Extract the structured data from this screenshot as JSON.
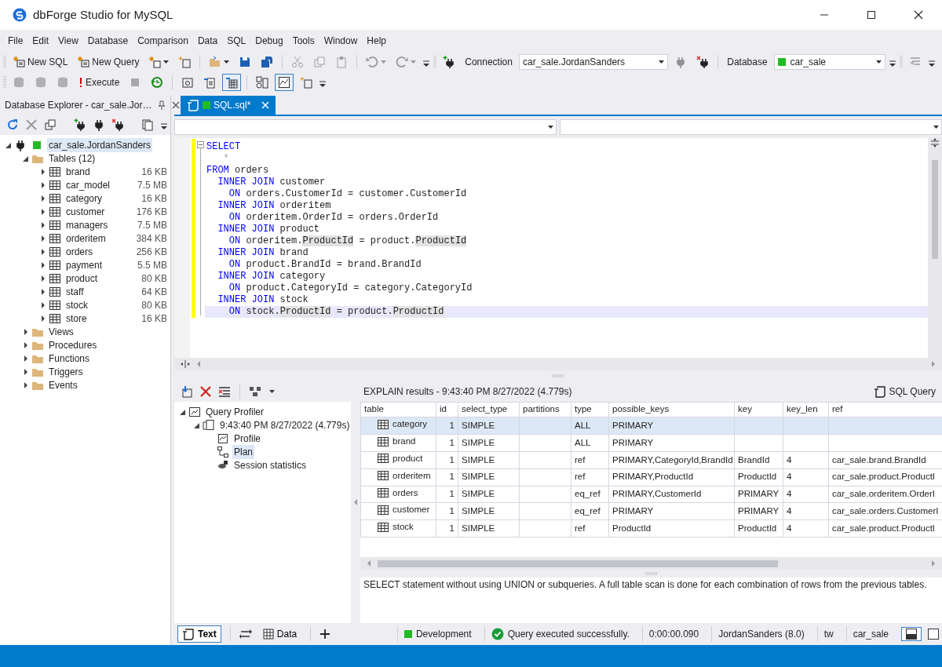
{
  "window": {
    "title": "dbForge Studio for MySQL"
  },
  "menu": [
    "File",
    "Edit",
    "View",
    "Database",
    "Comparison",
    "Data",
    "SQL",
    "Debug",
    "Tools",
    "Window",
    "Help"
  ],
  "toolbar_1": [
    {
      "kind": "button",
      "label": "New SQL"
    },
    {
      "kind": "button",
      "label": "New Query"
    },
    {
      "kind": "dropdown",
      "disabled": false,
      "pressed": false
    },
    {
      "kind": "icon",
      "disabled": false,
      "pressed": false
    },
    {
      "kind": "separator"
    },
    {
      "kind": "dropdown",
      "disabled": false,
      "pressed": false
    },
    {
      "kind": "icon",
      "disabled": false,
      "pressed": false
    },
    {
      "kind": "icon",
      "disabled": false,
      "pressed": false
    },
    {
      "kind": "separator"
    },
    {
      "kind": "icon",
      "disabled": true,
      "pressed": false
    },
    {
      "kind": "icon",
      "disabled": true,
      "pressed": false
    },
    {
      "kind": "icon",
      "disabled": true,
      "pressed": false
    },
    {
      "kind": "separator"
    },
    {
      "kind": "dropdown",
      "disabled": true,
      "pressed": false
    },
    {
      "kind": "dropdown",
      "disabled": true,
      "pressed": false
    },
    {
      "kind": "overflow"
    },
    {
      "kind": "grip"
    },
    {
      "kind": "icon",
      "disabled": false,
      "pressed": false
    },
    {
      "kind": "label",
      "label": "Connection"
    },
    {
      "kind": "combo",
      "value": "car_sale.JordanSanders"
    },
    {
      "kind": "icon",
      "disabled": true,
      "pressed": false
    },
    {
      "kind": "icon",
      "disabled": false,
      "pressed": false
    },
    {
      "kind": "separator"
    },
    {
      "kind": "label",
      "label": "Database"
    },
    {
      "kind": "combo",
      "value": "car_sale",
      "color": "#22bb22"
    },
    {
      "kind": "overflow"
    },
    {
      "kind": "grip"
    },
    {
      "kind": "icon",
      "disabled": true,
      "pressed": false
    },
    {
      "kind": "overflow"
    }
  ],
  "toolbar_2": [
    {
      "kind": "icon",
      "disabled": true,
      "pressed": false
    },
    {
      "kind": "icon",
      "disabled": true,
      "pressed": false
    },
    {
      "kind": "icon",
      "disabled": true,
      "pressed": false
    },
    {
      "kind": "button",
      "label": "Execute"
    },
    {
      "kind": "icon",
      "disabled": true,
      "pressed": false
    },
    {
      "kind": "icon",
      "disabled": false,
      "pressed": false
    },
    {
      "kind": "separator"
    },
    {
      "kind": "icon",
      "disabled": false,
      "pressed": false
    },
    {
      "kind": "icon",
      "disabled": false,
      "pressed": false
    },
    {
      "kind": "icon",
      "disabled": false,
      "pressed": true
    },
    {
      "kind": "separator"
    },
    {
      "kind": "icon",
      "disabled": false,
      "pressed": false
    },
    {
      "kind": "icon",
      "disabled": false,
      "pressed": true
    },
    {
      "kind": "icon",
      "disabled": false,
      "pressed": false
    },
    {
      "kind": "overflow"
    }
  ],
  "explorer": {
    "title": "Database Explorer - car_sale.Jor…",
    "tree": [
      {
        "kind": "connection",
        "label": "car_sale.JordanSanders",
        "selected": true,
        "expanded": true,
        "color": "#22bb22",
        "children": [
          {
            "kind": "folder",
            "label": "Tables (12)",
            "selected": false,
            "expanded": true,
            "children": [
              {
                "kind": "table",
                "label": "brand",
                "size": "16 KB",
                "selected": false,
                "expanded": false
              },
              {
                "kind": "table",
                "label": "car_model",
                "size": "7.5 MB",
                "selected": false,
                "expanded": false
              },
              {
                "kind": "table",
                "label": "category",
                "size": "16 KB",
                "selected": false,
                "expanded": false
              },
              {
                "kind": "table",
                "label": "customer",
                "size": "176 KB",
                "selected": false,
                "expanded": false
              },
              {
                "kind": "table",
                "label": "managers",
                "size": "7.5 MB",
                "selected": false,
                "expanded": false
              },
              {
                "kind": "table",
                "label": "orderitem",
                "size": "384 KB",
                "selected": false,
                "expanded": false
              },
              {
                "kind": "table",
                "label": "orders",
                "size": "256 KB",
                "selected": false,
                "expanded": false
              },
              {
                "kind": "table",
                "label": "payment",
                "size": "5.5 MB",
                "selected": false,
                "expanded": false
              },
              {
                "kind": "table",
                "label": "product",
                "size": "80 KB",
                "selected": false,
                "expanded": false
              },
              {
                "kind": "table",
                "label": "staff",
                "size": "64 KB",
                "selected": false,
                "expanded": false
              },
              {
                "kind": "table",
                "label": "stock",
                "size": "80 KB",
                "selected": false,
                "expanded": false
              },
              {
                "kind": "table",
                "label": "store",
                "size": "16 KB",
                "selected": false,
                "expanded": false
              }
            ]
          },
          {
            "kind": "folder",
            "label": "Views",
            "selected": false,
            "expanded": false
          },
          {
            "kind": "folder",
            "label": "Procedures",
            "selected": false,
            "expanded": false
          },
          {
            "kind": "folder",
            "label": "Functions",
            "selected": false,
            "expanded": false
          },
          {
            "kind": "folder",
            "label": "Triggers",
            "selected": false,
            "expanded": false
          },
          {
            "kind": "folder",
            "label": "Events",
            "selected": false,
            "expanded": false
          }
        ]
      }
    ]
  },
  "document_tabs": [
    {
      "label": "SQL.sql*",
      "selected": true,
      "color": "#22bb22"
    }
  ],
  "editor": {
    "lines": [
      {
        "current": false,
        "segments": [
          {
            "kind": "keyword",
            "text": "SELECT"
          }
        ]
      },
      {
        "current": false,
        "segments": [
          {
            "kind": "dim",
            "text": "   *"
          }
        ]
      },
      {
        "current": false,
        "segments": [
          {
            "kind": "keyword",
            "text": "FROM"
          },
          {
            "kind": "plain",
            "text": " orders"
          }
        ]
      },
      {
        "current": false,
        "segments": [
          {
            "kind": "keyword",
            "text": "  INNER JOIN"
          },
          {
            "kind": "plain",
            "text": " customer"
          }
        ]
      },
      {
        "current": false,
        "segments": [
          {
            "kind": "keyword",
            "text": "    ON"
          },
          {
            "kind": "plain",
            "text": " orders.CustomerId = customer.CustomerId"
          }
        ]
      },
      {
        "current": false,
        "segments": [
          {
            "kind": "keyword",
            "text": "  INNER JOIN"
          },
          {
            "kind": "plain",
            "text": " orderitem"
          }
        ]
      },
      {
        "current": false,
        "segments": [
          {
            "kind": "keyword",
            "text": "    ON"
          },
          {
            "kind": "plain",
            "text": " orderitem.OrderId = orders.OrderId"
          }
        ]
      },
      {
        "current": false,
        "segments": [
          {
            "kind": "keyword",
            "text": "  INNER JOIN"
          },
          {
            "kind": "plain",
            "text": " product"
          }
        ]
      },
      {
        "current": false,
        "segments": [
          {
            "kind": "keyword",
            "text": "    ON"
          },
          {
            "kind": "plain",
            "text": " orderitem."
          },
          {
            "kind": "match",
            "text": "ProductId"
          },
          {
            "kind": "plain",
            "text": " = product."
          },
          {
            "kind": "match",
            "text": "ProductId"
          }
        ]
      },
      {
        "current": false,
        "segments": [
          {
            "kind": "keyword",
            "text": "  INNER JOIN"
          },
          {
            "kind": "plain",
            "text": " brand"
          }
        ]
      },
      {
        "current": false,
        "segments": [
          {
            "kind": "keyword",
            "text": "    ON"
          },
          {
            "kind": "plain",
            "text": " product.BrandId = brand.BrandId"
          }
        ]
      },
      {
        "current": false,
        "segments": [
          {
            "kind": "keyword",
            "text": "  INNER JOIN"
          },
          {
            "kind": "plain",
            "text": " category"
          }
        ]
      },
      {
        "current": false,
        "segments": [
          {
            "kind": "keyword",
            "text": "    ON"
          },
          {
            "kind": "plain",
            "text": " product.CategoryId = category.CategoryId"
          }
        ]
      },
      {
        "current": false,
        "segments": [
          {
            "kind": "keyword",
            "text": "  INNER JOIN"
          },
          {
            "kind": "plain",
            "text": " stock"
          }
        ]
      },
      {
        "current": true,
        "segments": [
          {
            "kind": "keyword",
            "text": "    ON"
          },
          {
            "kind": "plain",
            "text": " stock."
          },
          {
            "kind": "match",
            "text": "ProductId"
          },
          {
            "kind": "plain",
            "text": " = product."
          },
          {
            "kind": "match",
            "text": "ProductId"
          }
        ]
      }
    ]
  },
  "results": {
    "heading": "EXPLAIN results - 9:43:40 PM 8/27/2022 (4.779s)",
    "sql_query_button": "SQL Query",
    "tree": [
      {
        "kind": "profiler",
        "label": "Query Profiler",
        "selected": false,
        "expanded": true,
        "children": [
          {
            "kind": "session",
            "label": "9:43:40 PM 8/27/2022 (4.779s)",
            "selected": false,
            "expanded": true,
            "children": [
              {
                "kind": "profile",
                "label": "Profile",
                "selected": false
              },
              {
                "kind": "plan",
                "label": "Plan",
                "selected": true
              },
              {
                "kind": "stats",
                "label": "Session statistics",
                "selected": false
              }
            ]
          }
        ]
      }
    ],
    "table": {
      "columns": [
        "table",
        "id",
        "select_type",
        "partitions",
        "type",
        "possible_keys",
        "key",
        "key_len",
        "ref"
      ],
      "rows": [
        {
          "selected": true,
          "cells": [
            "category",
            "1",
            "SIMPLE",
            "",
            "ALL",
            "PRIMARY",
            "",
            "",
            ""
          ]
        },
        {
          "selected": false,
          "cells": [
            "brand",
            "1",
            "SIMPLE",
            "",
            "ALL",
            "PRIMARY",
            "",
            "",
            ""
          ]
        },
        {
          "selected": false,
          "cells": [
            "product",
            "1",
            "SIMPLE",
            "",
            "ref",
            "PRIMARY,CategoryId,BrandId",
            "BrandId",
            "4",
            "car_sale.brand.BrandId"
          ]
        },
        {
          "selected": false,
          "cells": [
            "orderitem",
            "1",
            "SIMPLE",
            "",
            "ref",
            "PRIMARY,ProductId",
            "ProductId",
            "4",
            "car_sale.product.ProductI"
          ]
        },
        {
          "selected": false,
          "cells": [
            "orders",
            "1",
            "SIMPLE",
            "",
            "eq_ref",
            "PRIMARY,CustomerId",
            "PRIMARY",
            "4",
            "car_sale.orderitem.OrderI"
          ]
        },
        {
          "selected": false,
          "cells": [
            "customer",
            "1",
            "SIMPLE",
            "",
            "eq_ref",
            "PRIMARY",
            "PRIMARY",
            "4",
            "car_sale.orders.CustomerI"
          ]
        },
        {
          "selected": false,
          "cells": [
            "stock",
            "1",
            "SIMPLE",
            "",
            "ref",
            "ProductId",
            "ProductId",
            "4",
            "car_sale.product.ProductI"
          ]
        }
      ]
    },
    "description": "SELECT statement without using UNION or subqueries. A full table scan is done for each combination of rows from the previous tables."
  },
  "view_tabs": [
    {
      "label": "Text",
      "selected": true
    },
    {
      "label": "Data",
      "selected": false
    }
  ],
  "status": [
    {
      "kind": "environment",
      "text": "Development",
      "color": "#22bb22"
    },
    {
      "kind": "success",
      "text": "Query executed successfully."
    },
    {
      "kind": "text",
      "text": "0:00:00.090"
    },
    {
      "kind": "text",
      "text": "JordanSanders (8.0)"
    },
    {
      "kind": "text",
      "text": "tw"
    },
    {
      "kind": "text",
      "text": "car_sale"
    }
  ]
}
